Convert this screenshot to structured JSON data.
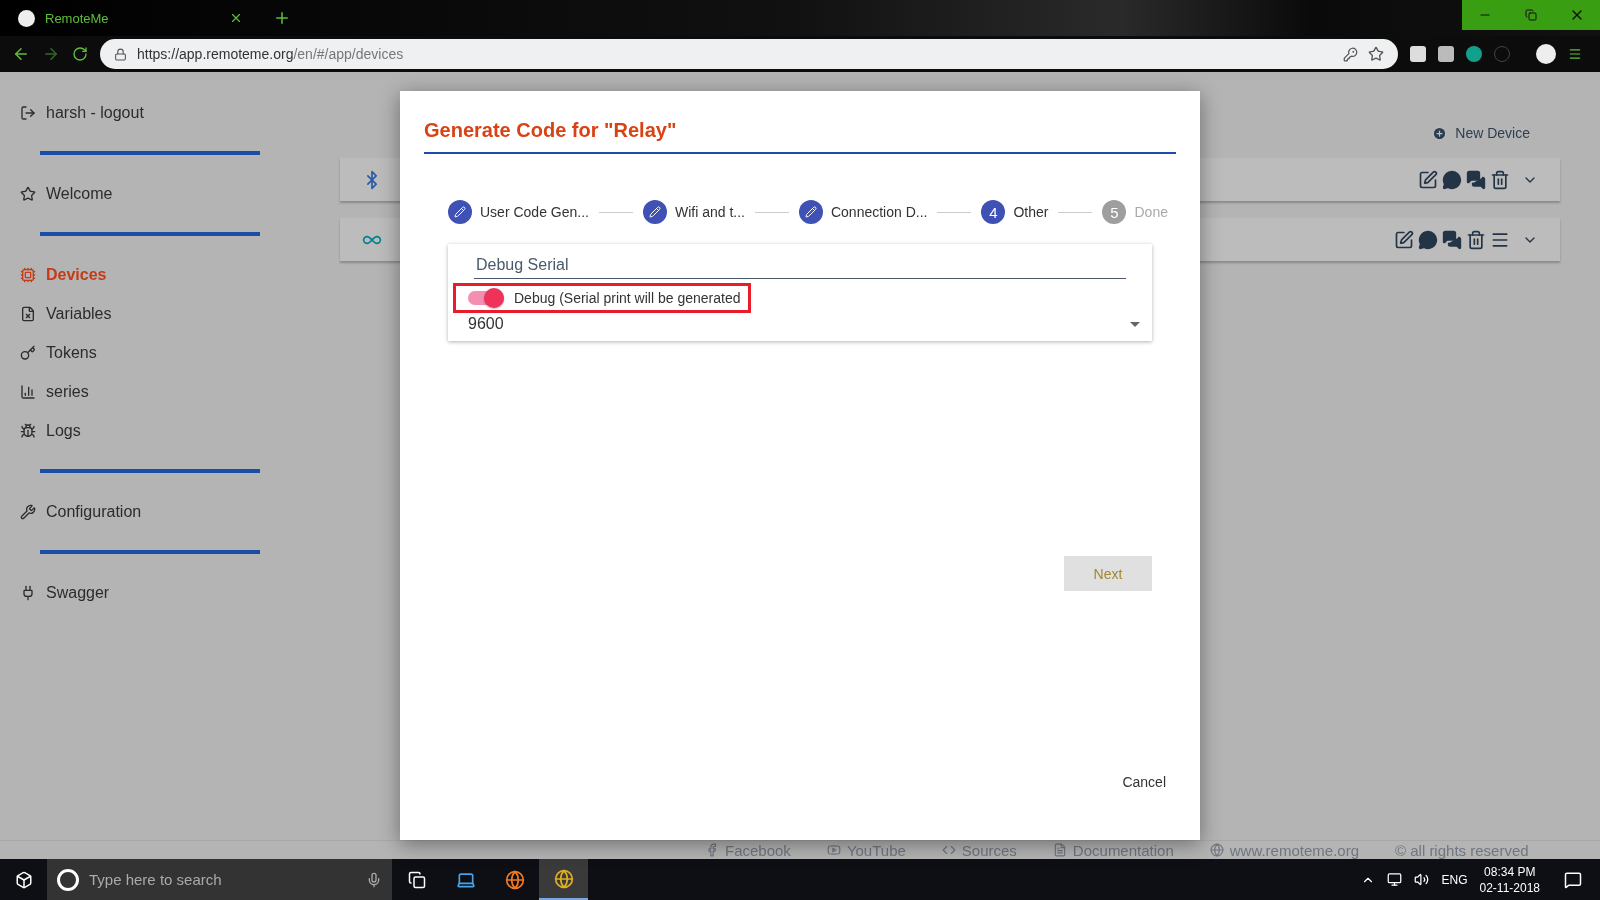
{
  "browser": {
    "tab_title": "RemoteMe",
    "url_host": "https://app.remoteme.org",
    "url_path": "/en/#/app/devices"
  },
  "sidebar": {
    "sections": [
      [
        {
          "label": "harsh - logout",
          "selected": false
        }
      ],
      [
        {
          "label": "Welcome",
          "selected": false
        }
      ],
      [
        {
          "label": "Devices",
          "selected": true
        },
        {
          "label": "Variables",
          "selected": false
        },
        {
          "label": "Tokens",
          "selected": false
        },
        {
          "label": "series",
          "selected": false
        },
        {
          "label": "Logs",
          "selected": false
        }
      ],
      [
        {
          "label": "Configuration",
          "selected": false
        }
      ],
      [
        {
          "label": "Swagger",
          "selected": false
        }
      ]
    ]
  },
  "new_device": "New Device",
  "devices": [
    {
      "kind": "bluetooth",
      "has_menu": false
    },
    {
      "kind": "arduino",
      "has_menu": true
    }
  ],
  "dialog": {
    "title": "Generate Code for \"Relay\"",
    "steps": [
      {
        "label": "User Code Gen...",
        "kind": "done"
      },
      {
        "label": "Wifi and t...",
        "kind": "done"
      },
      {
        "label": "Connection D...",
        "kind": "done"
      },
      {
        "label": "Other",
        "number": "4",
        "kind": "current"
      },
      {
        "label": "Done",
        "number": "5",
        "kind": "upcoming"
      }
    ],
    "section_title": "Debug Serial",
    "toggle": {
      "label": "Debug (Serial print will be generated",
      "on": true,
      "highlighted": true
    },
    "select": {
      "value": "9600"
    },
    "next": "Next",
    "cancel": "Cancel"
  },
  "footer": [
    {
      "label": "Facebook"
    },
    {
      "label": "YouTube"
    },
    {
      "label": "Sources"
    },
    {
      "label": "Documentation"
    },
    {
      "label": "www.remoteme.org"
    },
    {
      "label": "© all rights reserved"
    }
  ],
  "taskbar": {
    "search_placeholder": "Type here to search",
    "language": "ENG",
    "time": "08:34 PM",
    "date": "02-11-2018"
  }
}
